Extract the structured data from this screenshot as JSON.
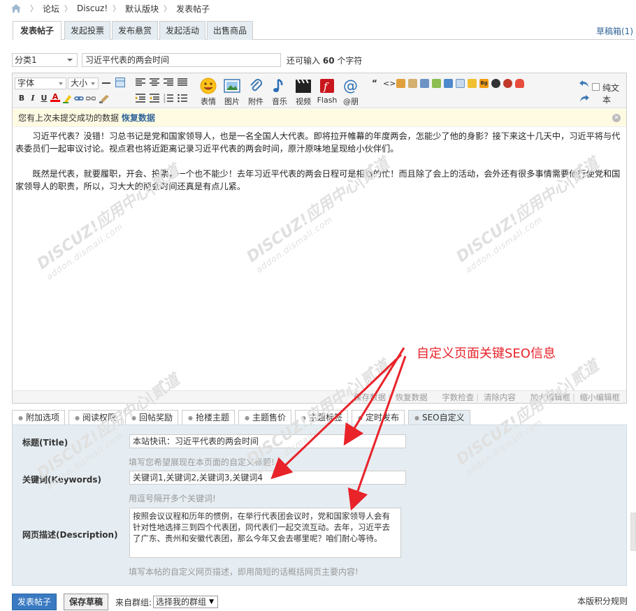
{
  "breadcrumb": {
    "items": [
      "论坛",
      "Discuz!",
      "默认版块",
      "发表帖子"
    ]
  },
  "tabs": [
    {
      "label": "发表帖子",
      "active": true
    },
    {
      "label": "发起投票",
      "active": false
    },
    {
      "label": "发布悬赏",
      "active": false
    },
    {
      "label": "发起活动",
      "active": false
    },
    {
      "label": "出售商品",
      "active": false
    }
  ],
  "drafts_link": "草稿箱(1)",
  "subject": {
    "category_value": "分类1",
    "title_value": "习近平代表的两会时间",
    "remain_prefix": "还可输入",
    "remain_count": "60",
    "remain_suffix": "个字符"
  },
  "toolbar": {
    "font_select": "字体",
    "size_select": "大小",
    "bold": "B",
    "italic": "I",
    "underline": "U",
    "forecolor": "A",
    "big_buttons": [
      "表情",
      "图片",
      "附件",
      "音乐",
      "视频",
      "Flash",
      "@朋"
    ],
    "plain_text": "纯文本"
  },
  "notice": {
    "text": "您有上次未提交成功的数据",
    "link": "恢复数据"
  },
  "content": {
    "paragraphs": [
      "习近平代表？没错！习总书记是党和国家领导人，也是一名全国人大代表。即将拉开帷幕的年度两会，怎能少了他的身影？接下来这十几天中，习近平将与代表委员们一起审议讨论。视点君也将近距离记录习近平代表的两会时间，原汁原味地呈现给小伙伴们。",
      "既然是代表，就要履职，开会、投票，一个也不能少！去年习近平代表的两会日程可是相当的忙！而且除了会上的活动，会外还有很多事情需要他行使党和国家领导人的职责，所以，习大大的两会时间还真是有点儿紧。"
    ]
  },
  "status_bar": [
    "保存数据",
    "恢复数据",
    "字数检查",
    "清除内容",
    "加大编辑框",
    "缩小编辑框"
  ],
  "watermark": {
    "main": "DISCUZ!应用中心|贰道",
    "sub": "addon.dismall.com"
  },
  "bottom_tabs": [
    {
      "label": "附加选项",
      "active": false
    },
    {
      "label": "阅读权限",
      "active": false
    },
    {
      "label": "回帖奖励",
      "active": false
    },
    {
      "label": "抢楼主题",
      "active": false
    },
    {
      "label": "主题售价",
      "active": false
    },
    {
      "label": "主题标签",
      "active": false
    },
    {
      "label": "定时发布",
      "active": false
    },
    {
      "label": "SEO自定义",
      "active": true
    }
  ],
  "seo": {
    "title_label": "标题(Title)",
    "title_value": "本站快讯：习近平代表的两会时间",
    "title_hint": "填写您希望展现在本页面的自定义标题!",
    "keywords_label": "关键词(Keywords)",
    "keywords_value": "关键词1,关键词2,关键词3,关键词4",
    "keywords_hint": "用逗号隔开多个关键词!",
    "description_label": "网页描述(Description)",
    "description_value": "按照会议议程和历年的惯例，在举行代表团会议时，党和国家领导人会有针对性地选择三到四个代表团，同代表们一起交流互动。去年，习近平去了广东、贵州和安徽代表团，那么今年又会去哪里呢？咱们耐心等待。",
    "description_hint": "填写本帖的自定义网页描述，即用简短的话概括网页主要内容!"
  },
  "submit": {
    "post_button": "发表帖子",
    "draft_button": "保存草稿",
    "group_label": "来自群组:",
    "group_select": "选择我的群组",
    "rules_link": "本版积分规则"
  },
  "annotation": {
    "text": "自定义页面关键SEO信息",
    "color": "#e8232a"
  },
  "colors": {
    "tab_bg": "#e5edf2",
    "link": "#336699",
    "primary_button": "#3a7ac2",
    "notice_bg": "#fffbe3"
  }
}
